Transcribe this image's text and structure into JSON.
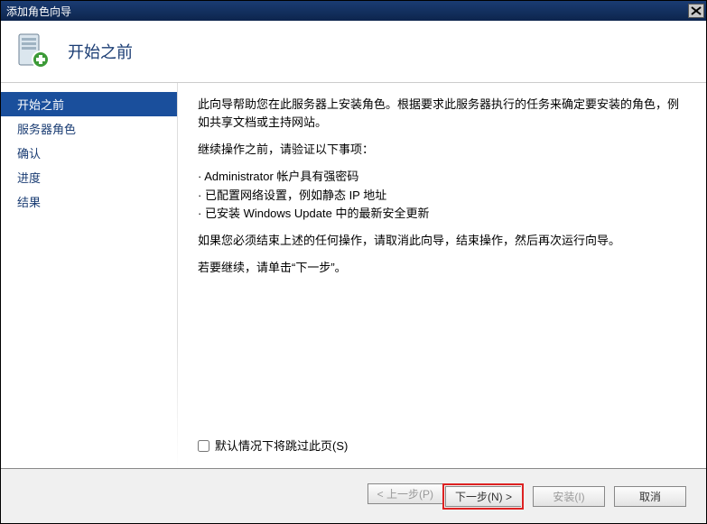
{
  "window": {
    "title": "添加角色向导"
  },
  "header": {
    "title": "开始之前"
  },
  "sidebar": {
    "items": [
      {
        "label": "开始之前",
        "active": true
      },
      {
        "label": "服务器角色",
        "active": false
      },
      {
        "label": "确认",
        "active": false
      },
      {
        "label": "进度",
        "active": false
      },
      {
        "label": "结果",
        "active": false
      }
    ]
  },
  "content": {
    "intro": "此向导帮助您在此服务器上安装角色。根据要求此服务器执行的任务来确定要安装的角色，例如共享文档或主持网站。",
    "verify_prompt": "继续操作之前，请验证以下事项：",
    "bullets": [
      "Administrator 帐户具有强密码",
      "已配置网络设置，例如静态 IP 地址",
      "已安装 Windows Update 中的最新安全更新"
    ],
    "cancel_hint": "如果您必须结束上述的任何操作，请取消此向导，结束操作，然后再次运行向导。",
    "continue_hint": "若要继续，请单击“下一步”。",
    "skip_checkbox_label": "默认情况下将跳过此页(S)"
  },
  "footer": {
    "prev": "< 上一步(P)",
    "next": "下一步(N) >",
    "install": "安装(I)",
    "cancel": "取消"
  }
}
